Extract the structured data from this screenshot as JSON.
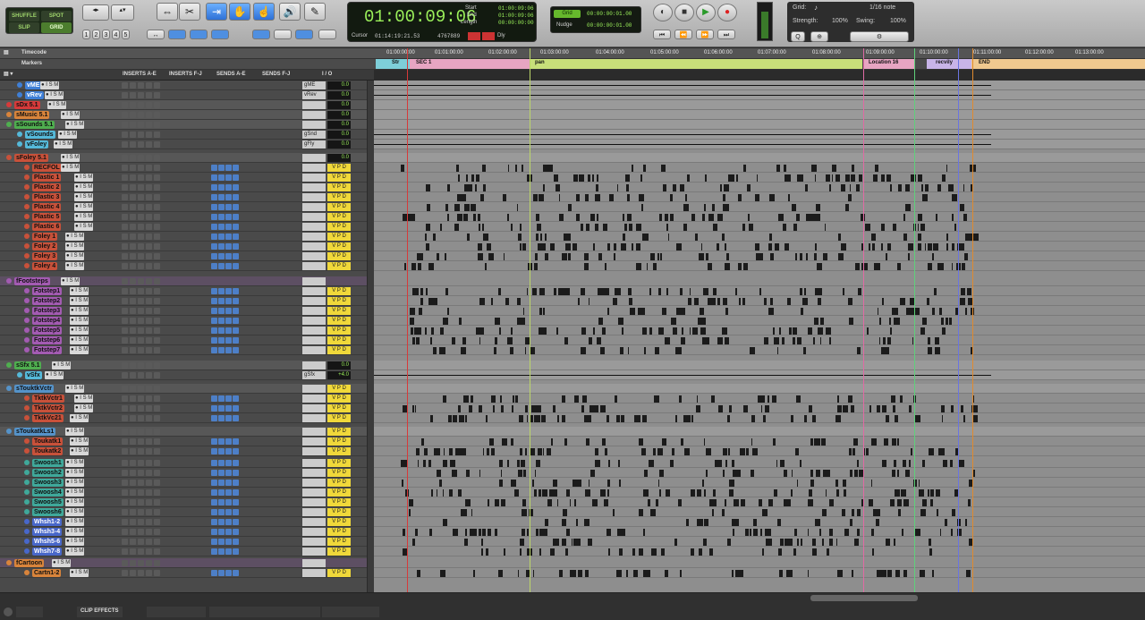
{
  "toolbar": {
    "modes": [
      "SHUFFLE",
      "SPOT",
      "SLIP",
      "GRID"
    ],
    "zoom_presets": [
      "1",
      "2",
      "3",
      "4",
      "5"
    ],
    "main_counter": "01:00:09:06",
    "start_label": "Start",
    "start_value": "01:00:09:06",
    "end_label": "End",
    "end_value": "01:00:09:06",
    "length_label": "Length",
    "length_value": "00:00:00:00",
    "cursor_label": "Cursor",
    "cursor_value": "01:14:19:21.53",
    "samples_value": "4767889",
    "dly_label": "Dly",
    "grid_label": "Grid",
    "grid_value": "00:00:00:01.00",
    "nudge_label": "Nudge",
    "nudge_value": "00:00:00:01.00",
    "grid_right_label": "Grid:",
    "grid_right_value": "1/16 note",
    "strength_label": "Strength:",
    "strength_value": "100%",
    "swing_label": "Swing:",
    "swing_value": "100%"
  },
  "rulers": {
    "timecode_label": "Timecode",
    "markers_label": "Markers",
    "ticks": [
      "01:00:00:00",
      "01:01:00:00",
      "01:02:00:00",
      "01:03:00:00",
      "01:04:00:00",
      "01:05:00:00",
      "01:06:00:00",
      "01:07:00:00",
      "01:08:00:00",
      "01:09:00:00",
      "01:10:00:00",
      "01:11:00:00",
      "01:12:00:00",
      "01:13:00:00"
    ],
    "markers": [
      "Str",
      "SEC 1",
      "pan",
      "Location 16",
      "recvily",
      "END"
    ]
  },
  "columns": [
    "INSERTS A-E",
    "INSERTS F-J",
    "SENDS A-E",
    "SENDS F-J",
    "I / O"
  ],
  "tracks": [
    {
      "name": "vME",
      "color": "#3f7fd6",
      "kind": "vca",
      "io": "gME",
      "vol": "0.0"
    },
    {
      "name": "vRev",
      "color": "#3f7fd6",
      "kind": "vca",
      "io": "vRev",
      "vol": "0.0"
    },
    {
      "name": "sDx 5.1",
      "color": "#d63a3a",
      "kind": "sub",
      "io": "",
      "vol": "0.0"
    },
    {
      "name": "sMusic 5.1",
      "color": "#d8843b",
      "kind": "sub",
      "io": "",
      "vol": "0.0"
    },
    {
      "name": "sSounds 5.1",
      "color": "#4fae4f",
      "kind": "sub",
      "io": "",
      "vol": "0.0"
    },
    {
      "name": "vSounds",
      "color": "#55b9d9",
      "kind": "vca",
      "io": "gSnd",
      "vol": "0.0"
    },
    {
      "name": "vFoley",
      "color": "#55b9d9",
      "kind": "vca",
      "io": "gFly",
      "vol": "0.0"
    },
    {
      "name": "sFoley 5.1",
      "color": "#c8513a",
      "kind": "sub",
      "io": "",
      "vol": "0.0"
    },
    {
      "name": "RECFOL",
      "color": "#c8513a",
      "kind": "audio",
      "io": "",
      "vol": "V P D"
    },
    {
      "name": "Plastic 1",
      "color": "#c8513a",
      "kind": "audio",
      "io": "",
      "vol": "V P D"
    },
    {
      "name": "Plastic 2",
      "color": "#c8513a",
      "kind": "audio",
      "io": "",
      "vol": "V P D"
    },
    {
      "name": "Plastic 3",
      "color": "#c8513a",
      "kind": "audio",
      "io": "",
      "vol": "V P D"
    },
    {
      "name": "Plastic 4",
      "color": "#c8513a",
      "kind": "audio",
      "io": "",
      "vol": "V P D"
    },
    {
      "name": "Plastic 5",
      "color": "#c8513a",
      "kind": "audio",
      "io": "",
      "vol": "V P D"
    },
    {
      "name": "Plastic 6",
      "color": "#c8513a",
      "kind": "audio",
      "io": "",
      "vol": "V P D"
    },
    {
      "name": "Foley 1",
      "color": "#c8513a",
      "kind": "audio",
      "io": "",
      "vol": "V P D"
    },
    {
      "name": "Foley 2",
      "color": "#c8513a",
      "kind": "audio",
      "io": "",
      "vol": "V P D"
    },
    {
      "name": "Foley 3",
      "color": "#c8513a",
      "kind": "audio",
      "io": "",
      "vol": "V P D"
    },
    {
      "name": "Foley 4",
      "color": "#c8513a",
      "kind": "audio",
      "io": "",
      "vol": "V P D"
    },
    {
      "name": "fFootsteps",
      "color": "#a35bb2",
      "kind": "folder",
      "io": "",
      "vol": ""
    },
    {
      "name": "Fotstep1",
      "color": "#a35bb2",
      "kind": "audio",
      "io": "",
      "vol": "V P D"
    },
    {
      "name": "Fotstep2",
      "color": "#a35bb2",
      "kind": "audio",
      "io": "",
      "vol": "V P D"
    },
    {
      "name": "Fotstep3",
      "color": "#a35bb2",
      "kind": "audio",
      "io": "",
      "vol": "V P D"
    },
    {
      "name": "Fotstep4",
      "color": "#a35bb2",
      "kind": "audio",
      "io": "",
      "vol": "V P D"
    },
    {
      "name": "Fotstep5",
      "color": "#a35bb2",
      "kind": "audio",
      "io": "",
      "vol": "V P D"
    },
    {
      "name": "Fotstep6",
      "color": "#a35bb2",
      "kind": "audio",
      "io": "",
      "vol": "V P D"
    },
    {
      "name": "Fotstep7",
      "color": "#a35bb2",
      "kind": "audio",
      "io": "",
      "vol": "V P D"
    },
    {
      "name": "sSfx 5.1",
      "color": "#4fae4f",
      "kind": "sub",
      "io": "",
      "vol": "0.0"
    },
    {
      "name": "vSfx",
      "color": "#55b9d9",
      "kind": "vca",
      "io": "gSfx",
      "vol": "+4.0"
    },
    {
      "name": "sTouktkVctr",
      "color": "#5593c9",
      "kind": "sub",
      "io": "",
      "vol": "V P D"
    },
    {
      "name": "TktkVctr1",
      "color": "#c8513a",
      "kind": "audio",
      "io": "",
      "vol": "V P D"
    },
    {
      "name": "TktkVctr2",
      "color": "#c8513a",
      "kind": "audio",
      "io": "",
      "vol": "V P D"
    },
    {
      "name": "TktkVc21",
      "color": "#c8513a",
      "kind": "audio",
      "io": "",
      "vol": "V P D"
    },
    {
      "name": "sToukatkLs1",
      "color": "#5593c9",
      "kind": "sub",
      "io": "",
      "vol": "V P D"
    },
    {
      "name": "Toukatk1",
      "color": "#c8513a",
      "kind": "audio",
      "io": "",
      "vol": "V P D"
    },
    {
      "name": "Toukatk2",
      "color": "#c8513a",
      "kind": "audio",
      "io": "",
      "vol": "V P D"
    },
    {
      "name": "Swoosh1",
      "color": "#3fa89a",
      "kind": "audio",
      "io": "",
      "vol": "V P D"
    },
    {
      "name": "Swoosh2",
      "color": "#3fa89a",
      "kind": "audio",
      "io": "",
      "vol": "V P D"
    },
    {
      "name": "Swoosh3",
      "color": "#3fa89a",
      "kind": "audio",
      "io": "",
      "vol": "V P D"
    },
    {
      "name": "Swoosh4",
      "color": "#3fa89a",
      "kind": "audio",
      "io": "",
      "vol": "V P D"
    },
    {
      "name": "Swoosh5",
      "color": "#3fa89a",
      "kind": "audio",
      "io": "",
      "vol": "V P D"
    },
    {
      "name": "Swoosh6",
      "color": "#3fa89a",
      "kind": "audio",
      "io": "",
      "vol": "V P D"
    },
    {
      "name": "Whsh1-2",
      "color": "#4867c9",
      "kind": "audio",
      "io": "",
      "vol": "V P D"
    },
    {
      "name": "Whsh3-4",
      "color": "#4867c9",
      "kind": "audio",
      "io": "",
      "vol": "V P D"
    },
    {
      "name": "Whsh5-6",
      "color": "#4867c9",
      "kind": "audio",
      "io": "",
      "vol": "V P D"
    },
    {
      "name": "Whsh7-8",
      "color": "#4867c9",
      "kind": "audio",
      "io": "",
      "vol": "V P D"
    },
    {
      "name": "fCartoon",
      "color": "#d8843b",
      "kind": "folder",
      "io": "",
      "vol": ""
    },
    {
      "name": "Cartn1-2",
      "color": "#d8843b",
      "kind": "audio",
      "io": "",
      "vol": "V P D"
    }
  ],
  "bottom_tabs": [
    "CLIP EFFECTS"
  ]
}
